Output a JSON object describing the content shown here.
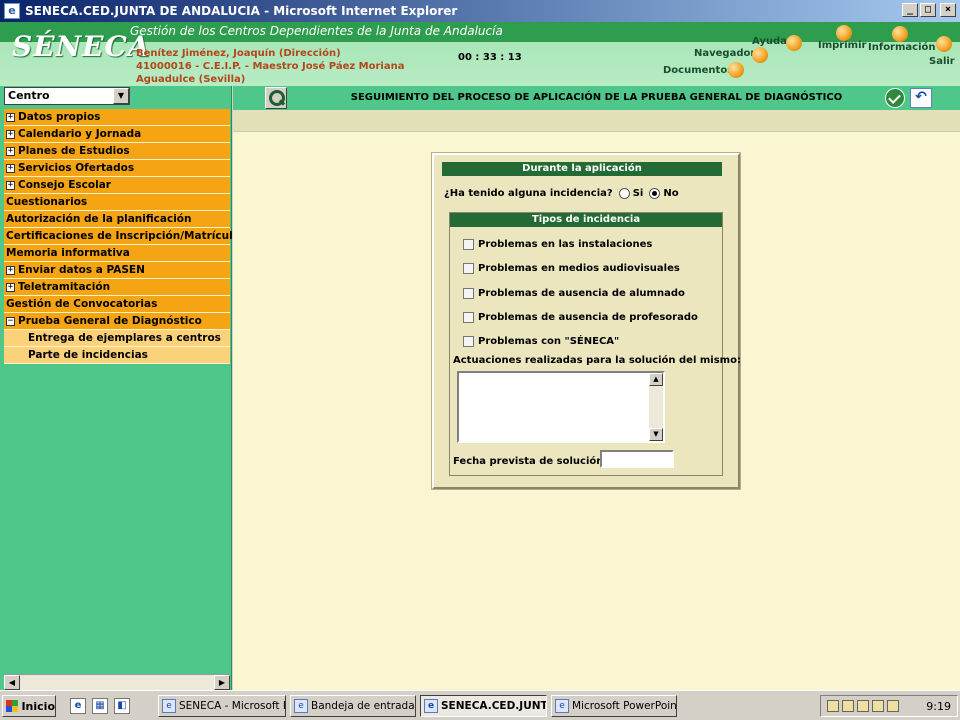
{
  "window": {
    "title": "SENECA.CED.JUNTA DE ANDALUCIA - Microsoft Internet Explorer",
    "icon": "ie-icon"
  },
  "header": {
    "logo": "SÉNECA",
    "subtitle": "Gestión de los Centros Dependientes de  la Junta de Andalucía",
    "user_line1": "Benítez Jiménez, Joaquín (Dirección)",
    "user_line2": "41000016 - C.E.I.P. - Maestro José Páez Moriana",
    "user_line3": "Aguadulce (Sevilla)",
    "clock": "00 : 33 : 13",
    "nav": {
      "ayuda": "Ayuda",
      "imprimir": "Imprimir",
      "informacion": "Información",
      "salir": "Salir",
      "navegador": "Navegador",
      "documentos": "Documentos"
    }
  },
  "sidebar": {
    "select_value": "Centro",
    "items": [
      {
        "label": "Datos propios",
        "expandable": true,
        "sub": false
      },
      {
        "label": "Calendario y Jornada",
        "expandable": true,
        "sub": false
      },
      {
        "label": "Planes de Estudios",
        "expandable": true,
        "sub": false
      },
      {
        "label": "Servicios Ofertados",
        "expandable": true,
        "sub": false
      },
      {
        "label": "Consejo Escolar",
        "expandable": true,
        "sub": false
      },
      {
        "label": "Cuestionarios",
        "expandable": false,
        "sub": false
      },
      {
        "label": "Autorización de la planificación",
        "expandable": false,
        "sub": false
      },
      {
        "label": "Certificaciones de Inscripción/Matrículas",
        "expandable": false,
        "sub": false
      },
      {
        "label": "Memoria informativa",
        "expandable": false,
        "sub": false
      },
      {
        "label": "Enviar datos a PASEN",
        "expandable": true,
        "sub": false
      },
      {
        "label": "Teletramitación",
        "expandable": true,
        "sub": false
      },
      {
        "label": "Gestión de Convocatorias",
        "expandable": false,
        "sub": false
      },
      {
        "label": "Prueba General de Diagnóstico",
        "expandable": true,
        "expanded": true,
        "sub": false
      },
      {
        "label": "Entrega de ejemplares a centros",
        "expandable": false,
        "sub": true
      },
      {
        "label": "Parte de incidencias",
        "expandable": false,
        "sub": true
      }
    ]
  },
  "main": {
    "title": "SEGUIMIENTO DEL PROCESO DE APLICACIÓN DE LA PRUEBA GENERAL DE DIAGNÓSTICO",
    "panel_title": "Durante la aplicación",
    "question": "¿Ha tenido alguna incidencia?",
    "option_si": "Si",
    "option_no": "No",
    "selected": "No",
    "types_title": "Tipos de incidencia",
    "checkboxes": [
      "Problemas en las instalaciones",
      "Problemas en medios audiovisuales",
      "Problemas de ausencia de alumnado",
      "Problemas de ausencia de profesorado",
      "Problemas con \"SÉNECA\""
    ],
    "actions_label": "Actuaciones realizadas para la solución del mismo:",
    "actions_value": "",
    "date_label": "Fecha prevista de solución:",
    "date_value": ""
  },
  "taskbar": {
    "start": "Inicio",
    "tasks": [
      {
        "label": "SENECA - Microsoft I...",
        "active": false
      },
      {
        "label": "Bandeja de entrada ...",
        "active": false
      },
      {
        "label": "SENECA.CED.JUNT...",
        "active": true
      },
      {
        "label": "Microsoft PowerPoin...",
        "active": false
      }
    ],
    "clock": "9:19"
  }
}
